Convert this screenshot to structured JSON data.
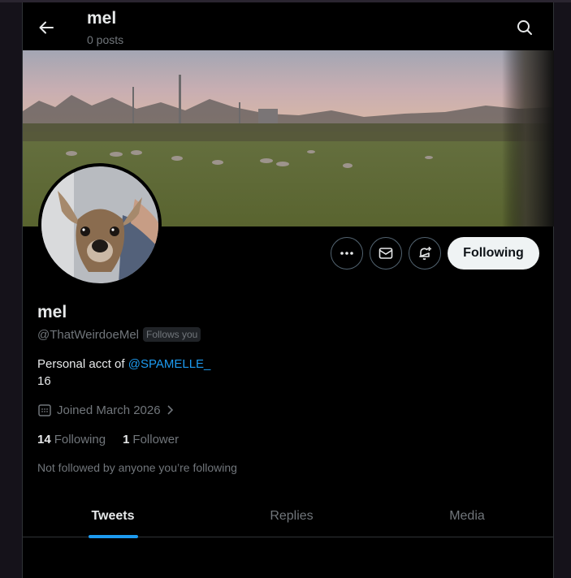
{
  "header": {
    "title": "mel",
    "subtitle": "0 posts",
    "back_icon": "arrow-left-icon",
    "search_icon": "search-icon"
  },
  "profile": {
    "name": "mel",
    "handle": "@ThatWeirdoeMel",
    "follows_you_badge": "Follows you",
    "bio_prefix": "Personal acct of ",
    "bio_mention": "@SPAMELLE_",
    "bio_line2": "16",
    "joined": "Joined March 2026",
    "following_count": "14",
    "following_label": "Following",
    "followers_count": "1",
    "followers_label": "Follower",
    "not_followed_text": "Not followed by anyone you’re following"
  },
  "actions": {
    "more_icon": "more-dots-icon",
    "message_icon": "envelope-icon",
    "notify_icon": "bell-plus-icon",
    "follow_label": "Following"
  },
  "tabs": [
    {
      "label": "Tweets",
      "active": true
    },
    {
      "label": "Replies",
      "active": false
    },
    {
      "label": "Media",
      "active": false
    }
  ],
  "colors": {
    "background": "#000000",
    "accent": "#1d9bf0",
    "text_primary": "#e7e9ea",
    "text_secondary": "#71767b"
  }
}
